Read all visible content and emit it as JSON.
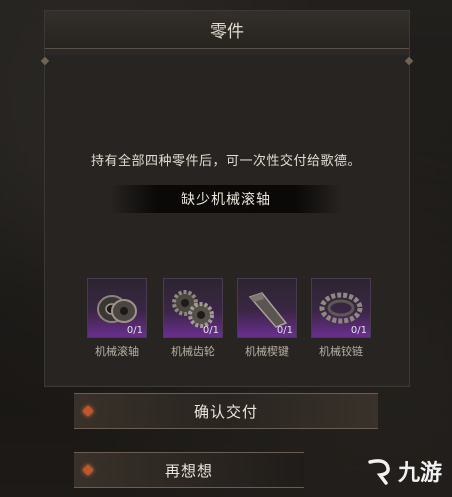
{
  "panel": {
    "title": "零件"
  },
  "message": {
    "instruction": "持有全部四种零件后，可一次性交付给歌德。",
    "missing": "缺少机械滚轴"
  },
  "parts": [
    {
      "name": "机械滚轴",
      "count": "0/1",
      "icon": "roller-bearing-icon"
    },
    {
      "name": "机械齿轮",
      "count": "0/1",
      "icon": "gears-icon"
    },
    {
      "name": "机械楔键",
      "count": "0/1",
      "icon": "wedge-key-icon"
    },
    {
      "name": "机械铰链",
      "count": "0/1",
      "icon": "chain-hinge-icon"
    }
  ],
  "buttons": {
    "confirm": "确认交付",
    "rethink": "再想想"
  },
  "watermark": {
    "text": "九游",
    "logo_icon": "jiuyou-logo-icon"
  },
  "colors": {
    "slot_gradient_purple": "#6a2f8f",
    "button_gem": "#c0562a",
    "text_light": "#e2dbd0"
  }
}
